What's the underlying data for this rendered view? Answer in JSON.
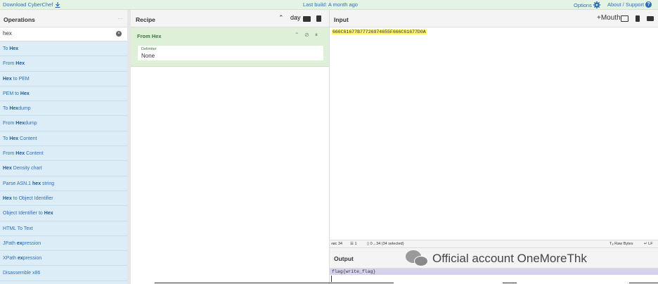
{
  "topbar": {
    "download_label": "Download CyberChef",
    "download_icon": "download-icon",
    "build_label": "Last build: A month ago",
    "options_label": "Options",
    "options_icon": "gear-icon",
    "about_label": "About / Support",
    "about_icon": "help-icon"
  },
  "operations": {
    "title": "Operations",
    "search_value": "hex",
    "items": [
      {
        "pre": "To ",
        "hl": "Hex",
        "post": ""
      },
      {
        "pre": "From ",
        "hl": "Hex",
        "post": ""
      },
      {
        "pre": "",
        "hl": "Hex",
        "post": " to PEM"
      },
      {
        "pre": "PEM to ",
        "hl": "Hex",
        "post": ""
      },
      {
        "pre": "To ",
        "hl": "Hex",
        "post": "dump"
      },
      {
        "pre": "From ",
        "hl": "Hex",
        "post": "dump"
      },
      {
        "pre": "To ",
        "hl": "Hex",
        "post": " Content"
      },
      {
        "pre": "From ",
        "hl": "Hex",
        "post": " Content"
      },
      {
        "pre": "",
        "hl": "Hex",
        "post": " Density chart"
      },
      {
        "pre": "Parse ASN.1 ",
        "hl": "hex",
        "post": " string"
      },
      {
        "pre": "",
        "hl": "Hex",
        "post": " to Object Identifier"
      },
      {
        "pre": "Object Identifier to ",
        "hl": "Hex",
        "post": ""
      },
      {
        "pre": "HTML To Text",
        "hl": "",
        "post": ""
      },
      {
        "pre": "JPath ",
        "hl": "ex",
        "post": "pression"
      },
      {
        "pre": "XPath ",
        "hl": "ex",
        "post": "pression"
      },
      {
        "pre": "Disassemble x86",
        "hl": "",
        "post": ""
      }
    ]
  },
  "recipe": {
    "title": "Recipe",
    "overlay_text": "day",
    "operation": {
      "name": "From Hex",
      "delimiter_label": "Delimiter",
      "delimiter_value": "None"
    }
  },
  "input": {
    "title": "Input",
    "overlay_text": "+Mouth",
    "value": "666C61677B77726974655F666C61677D0A",
    "status": {
      "length": "34",
      "lines": "1",
      "selection": "0→34 (34 selected)",
      "raw_bytes": "Raw Bytes",
      "line_ending": "LF"
    }
  },
  "output": {
    "title": "Output",
    "value": "flag{write_flag}"
  },
  "watermark": {
    "text": "Official account OneMoreThk",
    "icon": "wechat-icon"
  }
}
